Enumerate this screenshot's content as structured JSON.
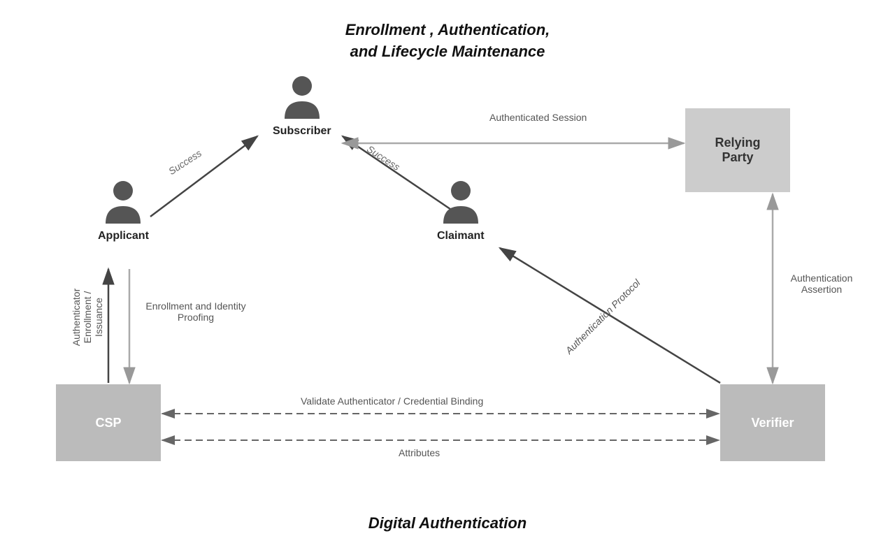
{
  "title": {
    "line1": "Enrollment ,  Authentication,",
    "line2": "and Lifecycle Maintenance"
  },
  "bottom_title": "Digital Authentication",
  "boxes": {
    "csp": "CSP",
    "verifier": "Verifier",
    "relying_party": "Relying\nParty"
  },
  "persons": {
    "subscriber": "Subscriber",
    "applicant": "Applicant",
    "claimant": "Claimant"
  },
  "arrow_labels": {
    "success_applicant_subscriber": "Success",
    "success_claimant_subscriber": "Success",
    "authenticated_session": "Authenticated\nSession",
    "authentication_assertion": "Authentication\nAssertion",
    "authenticator_enrollment": "Authenticator\nEnrollment /\nIssuance",
    "enrollment_identity": "Enrollment and\nIdentity Proofing",
    "authentication_protocol": "Authentication Protocol",
    "validate_authenticator": "Validate Authenticator / Credential Binding",
    "attributes": "Attributes"
  }
}
